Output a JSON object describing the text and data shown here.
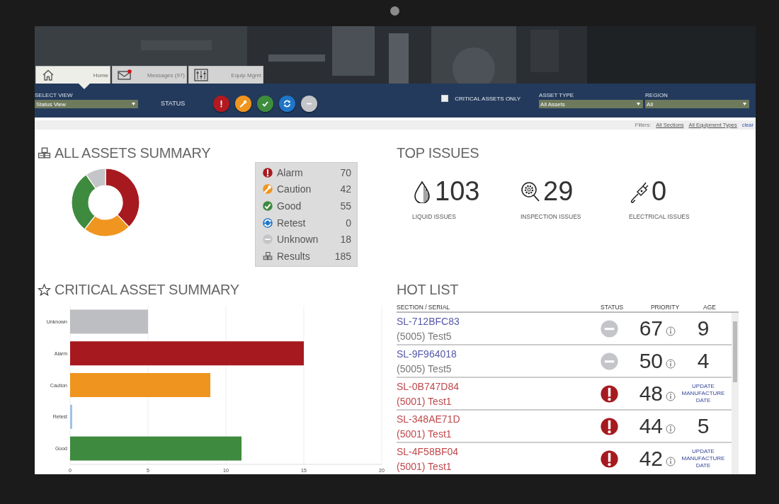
{
  "header": {
    "tabs": [
      {
        "label": "Home",
        "selected": true,
        "badge": false
      },
      {
        "label": "Messages (97)",
        "selected": false,
        "badge": true
      },
      {
        "label": "Equip Mgmt",
        "selected": false,
        "badge": false
      }
    ]
  },
  "toolbar": {
    "select_view": {
      "label": "SELECT VIEW",
      "value": "Status View"
    },
    "status_label": "STATUS",
    "status_buttons": [
      {
        "kind": "alarm",
        "color": "#b11a20"
      },
      {
        "kind": "caution",
        "color": "#f0951f"
      },
      {
        "kind": "good",
        "color": "#3e8d3e"
      },
      {
        "kind": "retest",
        "color": "#1f76c8"
      },
      {
        "kind": "unknown",
        "color": "#c4c5c8"
      }
    ],
    "critical_only": {
      "label": "CRITICAL ASSETS ONLY",
      "checked": false
    },
    "asset_type": {
      "label": "ASSET TYPE",
      "value": "All Assets"
    },
    "region": {
      "label": "REGION",
      "value": "All"
    }
  },
  "filters": {
    "label": "Filters:",
    "links": [
      "All Sections",
      "All Equipment Types"
    ],
    "clear": "clear"
  },
  "all_assets": {
    "title": "ALL ASSETS SUMMARY",
    "legend": [
      {
        "kind": "alarm",
        "label": "Alarm",
        "count": "70",
        "color": "#a61a1f"
      },
      {
        "kind": "caution",
        "label": "Caution",
        "count": "42",
        "color": "#f0951f"
      },
      {
        "kind": "good",
        "label": "Good",
        "count": "55",
        "color": "#3e8a3e"
      },
      {
        "kind": "retest",
        "label": "Retest",
        "count": "0",
        "color": "#1f76c8"
      },
      {
        "kind": "unknown",
        "label": "Unknown",
        "count": "18",
        "color": "#c4c5c8"
      },
      {
        "kind": "total",
        "label": "Results",
        "count": "185"
      }
    ]
  },
  "top_issues": {
    "title": "TOP ISSUES",
    "items": [
      {
        "kind": "liquid",
        "value": "103",
        "label": "LIQUID ISSUES"
      },
      {
        "kind": "inspection",
        "value": "29",
        "label": "INSPECTION ISSUES"
      },
      {
        "kind": "electrical",
        "value": "0",
        "label": "ELECTRICAL ISSUES"
      }
    ]
  },
  "critical_assets": {
    "title": "CRITICAL ASSET SUMMARY",
    "chart_data": {
      "type": "bar",
      "orientation": "horizontal",
      "grid": true,
      "series": [
        {
          "name": "Unknown",
          "color": "#bdbec1",
          "values": [
            5
          ]
        },
        {
          "name": "Alarm",
          "color": "#a61a1f",
          "values": [
            15
          ]
        },
        {
          "name": "Caution",
          "color": "#ef941f",
          "values": [
            9
          ]
        },
        {
          "name": "Retest",
          "values": [
            0
          ]
        },
        {
          "name": "Good",
          "color": "#3e8a3e",
          "values": [
            11
          ]
        }
      ],
      "xlim": [
        0,
        20
      ],
      "xticks": [
        0,
        5,
        10,
        15,
        20
      ]
    }
  },
  "hot_list": {
    "title": "HOT LIST",
    "columns": [
      "SECTION / SERIAL",
      "STATUS",
      "PRIORITY",
      "AGE"
    ],
    "rows": [
      {
        "serial": "SL-712BFC83",
        "section": "(5005) Test5",
        "kind": "unknown",
        "priority": "67",
        "age": "9"
      },
      {
        "serial": "SL-9F964018",
        "section": "(5005) Test5",
        "kind": "unknown",
        "priority": "50",
        "age": "4"
      },
      {
        "serial": "SL-0B747D84",
        "section": "(5001) Test1",
        "kind": "alarm",
        "priority": "48",
        "age_link": "UPDATE MANUFACTURE DATE"
      },
      {
        "serial": "SL-348AE71D",
        "section": "(5001) Test1",
        "kind": "alarm",
        "priority": "44",
        "age": "5"
      },
      {
        "serial": "SL-4F58BF04",
        "section": "(5001) Test1",
        "kind": "alarm",
        "priority": "42",
        "age_link": "UPDATE MANUFACTURE DATE"
      }
    ]
  }
}
